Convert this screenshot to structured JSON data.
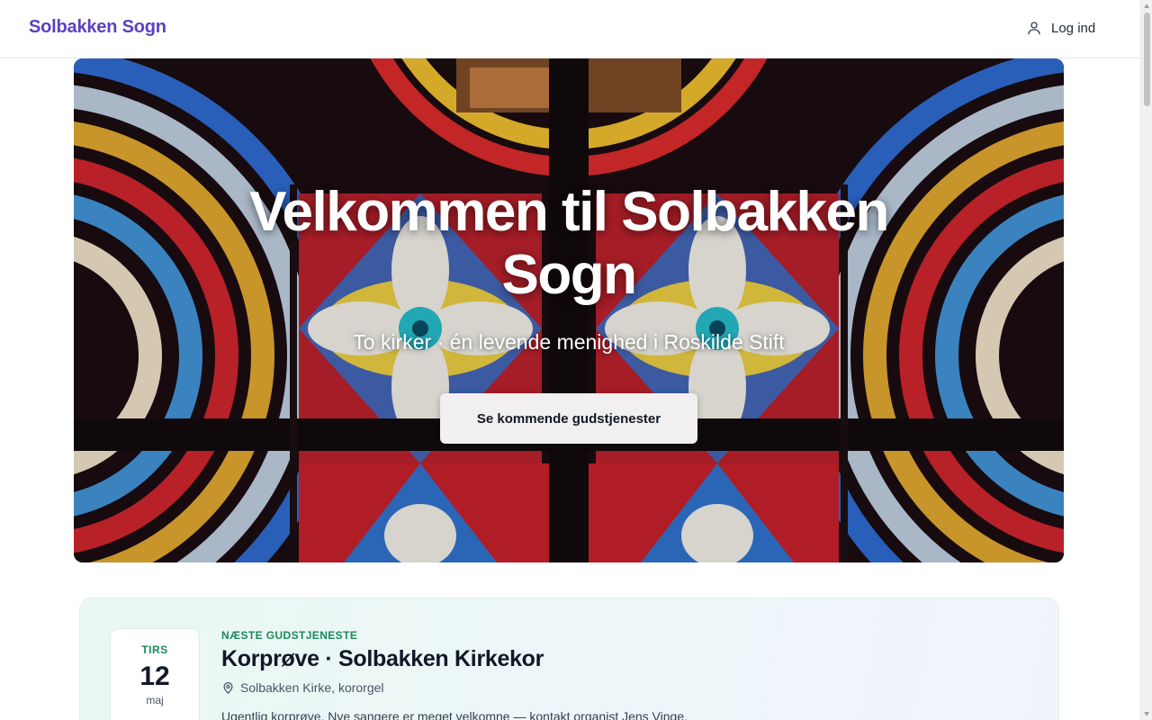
{
  "header": {
    "brand": "Solbakken Sogn",
    "login_label": "Log ind",
    "login_icon": "user-icon"
  },
  "hero": {
    "title": "Velkommen til Solbakken Sogn",
    "subtitle": "To kirker · én levende menighed i Roskilde Stift",
    "cta_label": "Se kommende gudstjenester"
  },
  "next_service": {
    "label": "NÆSTE GUDSTJENESTE",
    "weekday": "TIRS",
    "day": "12",
    "month": "maj",
    "title": "Korprøve · Solbakken Kirkekor",
    "location": "Solbakken Kirke, kororgel",
    "location_icon": "map-pin-icon",
    "description": "Ugentlig korprøve. Nye sangere er meget velkomne — kontakt organist Jens Vinge."
  },
  "colors": {
    "brand": "#5b3fc4",
    "accent_green": "#1b8a5a"
  }
}
